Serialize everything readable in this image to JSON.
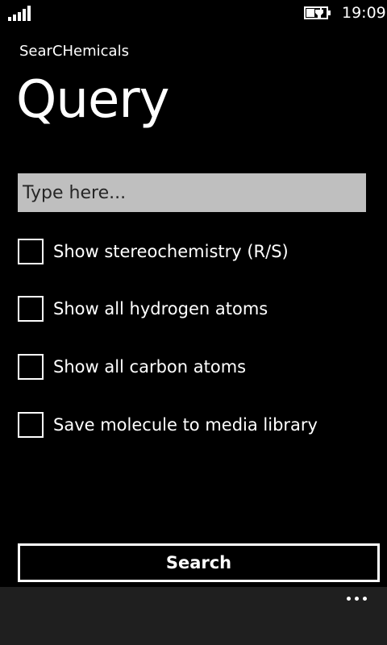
{
  "status_bar": {
    "time": "19:09",
    "signal_icon": "signal-strength-icon",
    "battery_icon": "battery-charging-icon"
  },
  "header": {
    "app_title": "SearCHemicals",
    "page_title": "Query"
  },
  "search": {
    "placeholder": "Type here...",
    "value": ""
  },
  "options": [
    {
      "label": "Show stereochemistry (R/S)",
      "checked": false
    },
    {
      "label": "Show all hydrogen atoms",
      "checked": false
    },
    {
      "label": "Show all carbon atoms",
      "checked": false
    },
    {
      "label": "Save molecule to media library",
      "checked": false
    }
  ],
  "actions": {
    "search_label": "Search"
  },
  "app_bar": {
    "more_icon": "more-options-icon"
  },
  "colors": {
    "background": "#000000",
    "foreground": "#ffffff",
    "input_background": "#bfbfbf",
    "app_bar_background": "#1f1f1f"
  }
}
